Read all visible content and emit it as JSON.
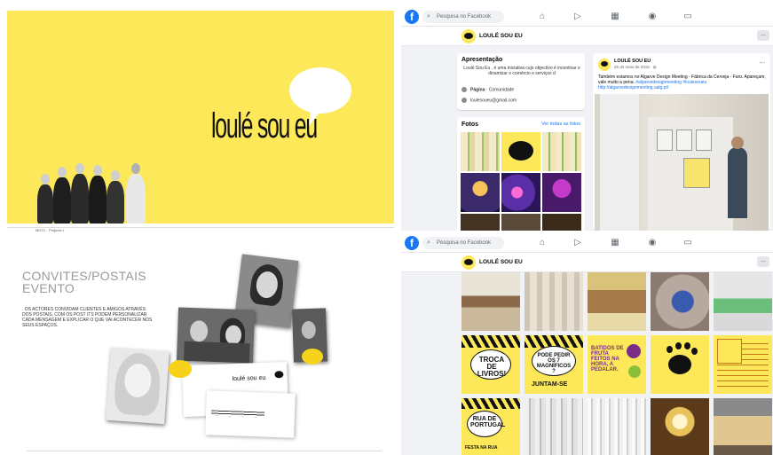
{
  "slide1": {
    "brand": "loulé sou eu",
    "caption": "MDTC · Projecto I"
  },
  "slide2": {
    "title": "CONVITES/POSTAIS EVENTO",
    "text": ". OS ACTORES CONVIDAM CLIENTES E AMIGOS ATRAVÉS DOS POSTAIS, COM OS POST ITS PODEM PERSONALIZAR CADA MENSAGEM E EXPLICAR O QUE VAI ACONTECER NOS SEUS ESPAÇOS.",
    "card_brand": "loulé sou eu"
  },
  "facebook": {
    "search_placeholder": "Pesquisa no Facebook",
    "page_name": "LOULÉ SOU EU",
    "more": "...",
    "intro": {
      "heading": "Apresentação",
      "description": "Loulé Sou Eu , é uma iniciativa cujo objectivo é incentivar e dinamizar o comércio e serviços d",
      "page_label": "Página",
      "page_type": " · Comunidade",
      "email": "loulesoueu@gmail.com"
    },
    "photos": {
      "heading": "Fotos",
      "see_all": "Ver todas as fotos"
    },
    "post": {
      "author": "LOULÉ SOU EU",
      "date": "26 de maio de 2016 · ",
      "text": "Também estamos no Algarve Design Meeting - Fábrica da Cerveja - Faro. Apareçam, vale muito a pena. ",
      "hashtags": "#algarvedesignmeeting #loulesoueu",
      "link": "http://algarvedesignmeeting.ualg.pt/",
      "more": "..."
    },
    "posters": {
      "troca": "TROCA DE LIVROS!",
      "magnificos": "PODE PEDIR OS 7 MAGNÍFICOS ?",
      "juntam": "JUNTAM-SE",
      "batidos": "BATIDOS DE FRUTA FEITOS NA HORA, A PEDALAR.",
      "rua": "RUA DE PORTUGAL",
      "festa": "FESTA NA RUA"
    }
  },
  "colors": {
    "yellow": "#fde85a",
    "facebook_blue": "#1877f2",
    "fb_bg": "#f0f2f5"
  }
}
